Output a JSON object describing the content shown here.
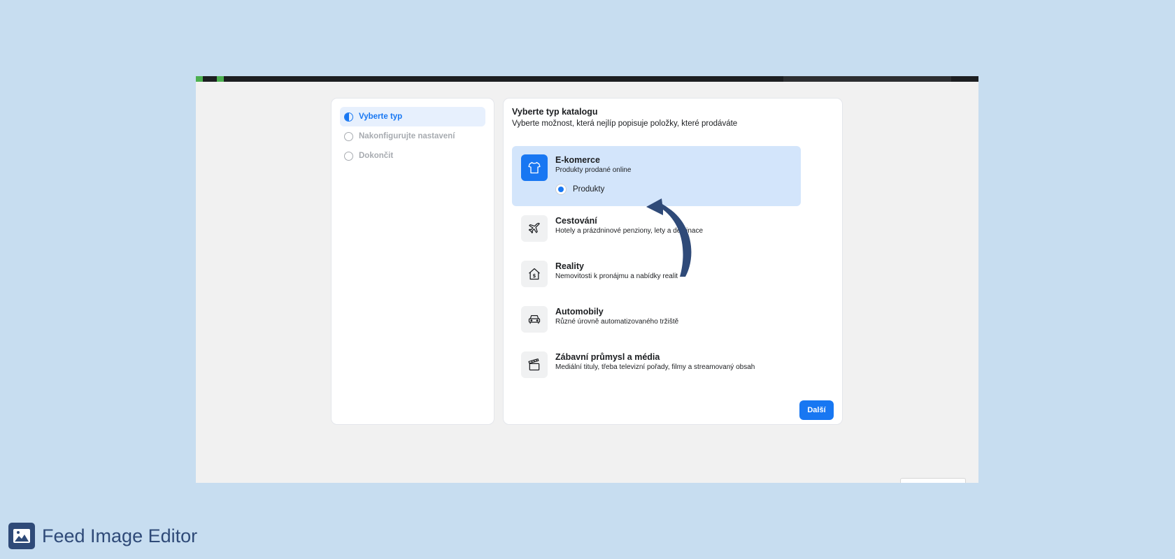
{
  "wizard_steps": [
    {
      "label": "Vyberte typ",
      "state": "active"
    },
    {
      "label": "Nakonfigurujte nastavení",
      "state": "pending"
    },
    {
      "label": "Dokončit",
      "state": "pending"
    }
  ],
  "main": {
    "title": "Vyberte typ katalogu",
    "subtitle": "Vyberte možnost, která nejlíp popisuje položky, které prodáváte",
    "options": [
      {
        "name": "E-komerce",
        "desc": "Produkty prodané online",
        "icon": "tshirt-icon",
        "selected": true,
        "sub_option": "Produkty"
      },
      {
        "name": "Cestování",
        "desc": "Hotely a prázdninové penziony, lety a destinace",
        "icon": "airplane-icon"
      },
      {
        "name": "Reality",
        "desc": "Nemovitosti k pronájmu a nabídky realit",
        "icon": "house-dollar-icon"
      },
      {
        "name": "Automobily",
        "desc": "Různé úrovně automatizovaného tržiště",
        "icon": "car-icon"
      },
      {
        "name": "Zábavní průmysl a média",
        "desc": "Mediální tituly, třeba televizní pořady, filmy a streamovaný obsah",
        "icon": "clapperboard-icon"
      }
    ],
    "next_label": "Další"
  },
  "footer": {
    "app_name": "Feed Image Editor"
  },
  "colors": {
    "accent": "#1877f2",
    "selected_option_bg": "#d3e5fb",
    "page_bg": "#c7ddf0",
    "arrow": "#2f4a78"
  }
}
